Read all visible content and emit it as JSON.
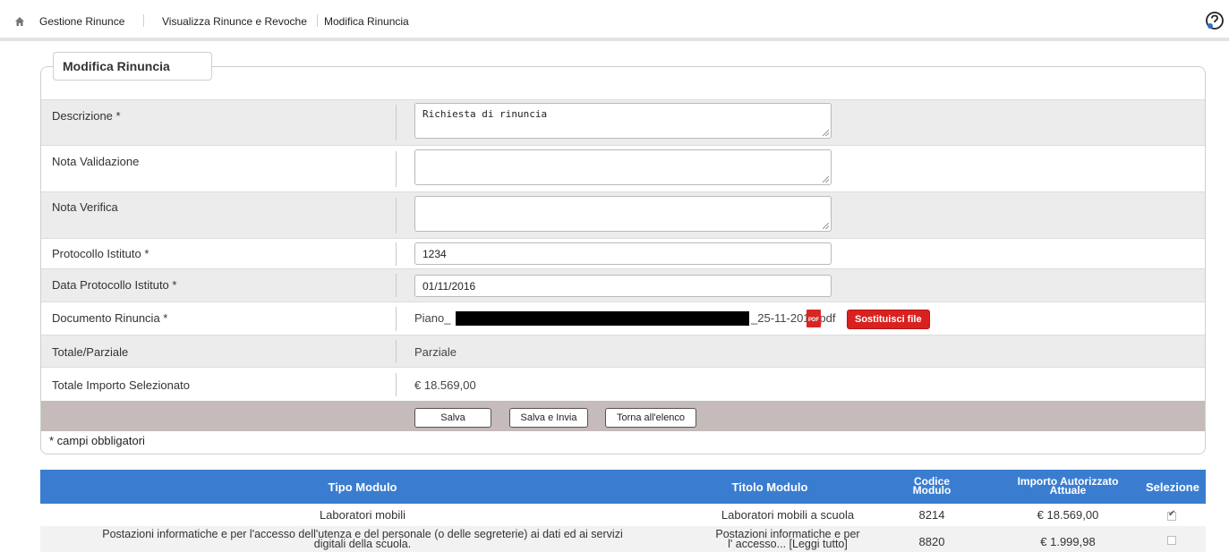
{
  "breadcrumb": {
    "home_icon": "home-icon",
    "items": [
      "Gestione Rinunce",
      "Visualizza Rinunce e Revoche",
      "Modifica Rinuncia"
    ]
  },
  "help_icon": "help-icon",
  "form": {
    "tab_title": "Modifica Rinuncia",
    "descrizione": {
      "label": "Descrizione *",
      "value": "Richiesta di rinuncia"
    },
    "nota_validazione": {
      "label": "Nota Validazione",
      "value": ""
    },
    "nota_verifica": {
      "label": "Nota Verifica",
      "value": ""
    },
    "protocollo": {
      "label": "Protocollo Istituto *",
      "value": "1234"
    },
    "data_protocollo": {
      "label": "Data Protocollo Istituto *",
      "value": "01/11/2016"
    },
    "documento": {
      "label": "Documento Rinuncia *",
      "file_prefix": "Piano_",
      "file_suffix": "_25-11-2015.pdf",
      "pdf_icon_text": "PDF",
      "replace_button": "Sostituisci file"
    },
    "totale_parziale": {
      "label": "Totale/Parziale",
      "value": "Parziale"
    },
    "totale_importo": {
      "label": "Totale Importo Selezionato",
      "value": "€ 18.569,00"
    },
    "buttons": {
      "save": "Salva",
      "save_send": "Salva e Invia",
      "back": "Torna all'elenco"
    },
    "required_note": "* campi obbligatori"
  },
  "table": {
    "headers": {
      "tipo": "Tipo Modulo",
      "titolo": "Titolo Modulo",
      "codice_1": "Codice",
      "codice_2": "Modulo",
      "importo_1": "Importo Autorizzato",
      "importo_2": "Attuale",
      "selezione": "Selezione"
    },
    "rows": [
      {
        "tipo": "Laboratori mobili",
        "titolo": "Laboratori mobili a scuola",
        "codice": "8214",
        "importo": "€ 18.569,00",
        "selected": true
      },
      {
        "tipo_1": "Postazioni informatiche e per l'accesso dell'utenza e del personale (o delle segreterie) ai dati ed ai servizi",
        "tipo_2": "digitali della scuola.",
        "titolo_1": "Postazioni informatiche e per",
        "titolo_2": "l' accesso... [Leggi tutto]",
        "codice": "8820",
        "importo": "€ 1.999,98",
        "selected": false
      }
    ]
  },
  "colors": {
    "header_blue": "#3a7dd0",
    "button_red": "#d9211f",
    "action_bar": "#c5bbbb"
  }
}
